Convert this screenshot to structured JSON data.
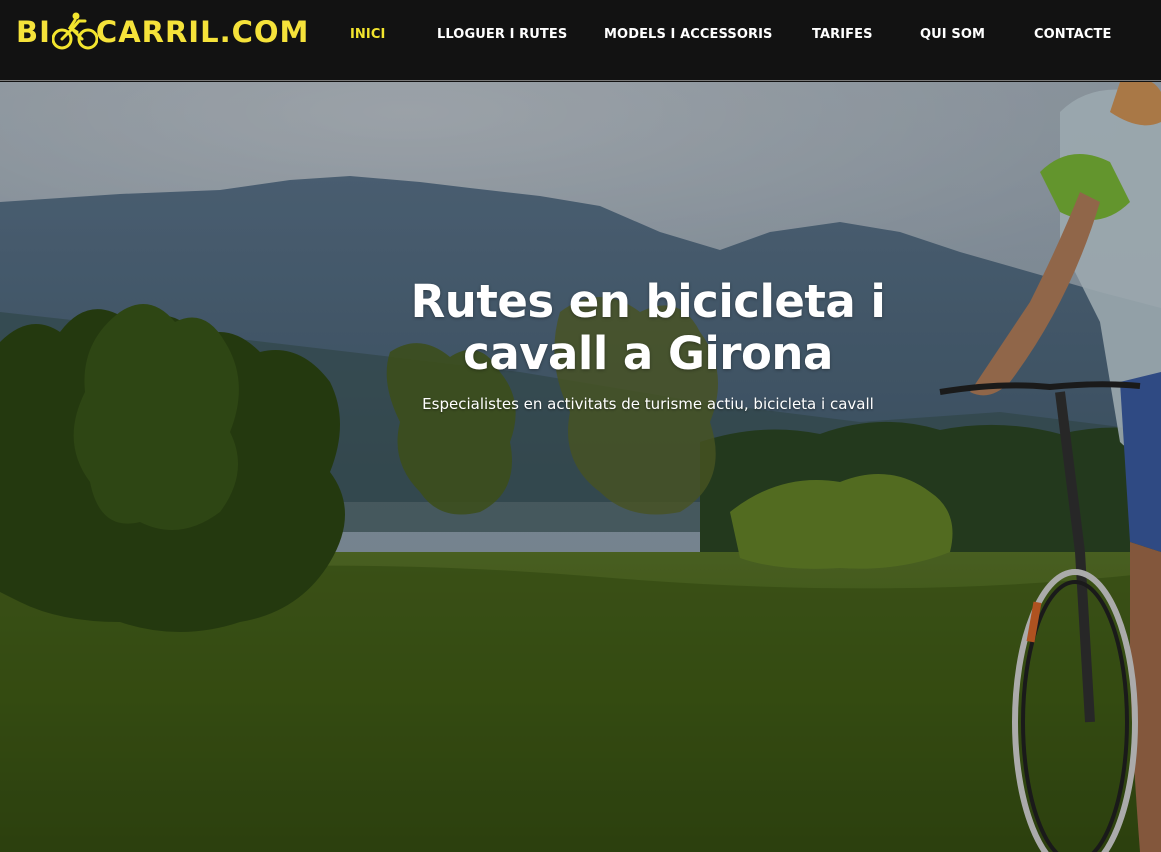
{
  "site": {
    "logo_text_before": "BI",
    "logo_text_after": "CARRIL.COM",
    "logo_icon": "cyclist-icon",
    "brand_color": "#f3e52e"
  },
  "nav": {
    "items": [
      {
        "label": "INICI",
        "active": true
      },
      {
        "label": "LLOGUER I RUTES",
        "active": false
      },
      {
        "label": "MODELS I ACCESSORIS",
        "active": false
      },
      {
        "label": "TARIFES",
        "active": false
      },
      {
        "label": "QUI SOM",
        "active": false
      },
      {
        "label": "CONTACTE",
        "active": false
      }
    ]
  },
  "hero": {
    "title": "Rutes en bicicleta i cavall a Girona",
    "subtitle": "Especialistes en activitats de turisme actiu, bicicleta i cavall"
  }
}
